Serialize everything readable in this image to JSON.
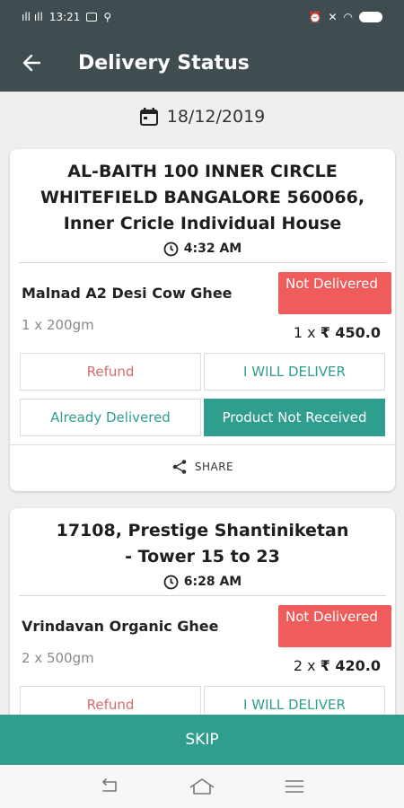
{
  "status_bar": {
    "carrier": "ıll ıll",
    "time": "13:21",
    "battery_icon": "battery-charging-icon"
  },
  "app_bar": {
    "title": "Delivery Status"
  },
  "date": "18/12/2019",
  "orders": [
    {
      "address": "AL-BAITH 100 INNER CIRCLE WHITEFIELD BANGALORE 560066, Inner Cricle Individual House",
      "time": "4:32 AM",
      "product": "Malnad A2 Desi Cow Ghee",
      "qty": "1 x 200gm",
      "status": "Not Delivered",
      "count": "1 x",
      "price": "₹ 450.0",
      "buttons": {
        "refund": "Refund",
        "deliver": "I WILL DELIVER",
        "already": "Already Delivered",
        "not_received": "Product Not Received"
      },
      "share": "SHARE"
    },
    {
      "address": "17108, Prestige Shantiniketan - Tower 15 to 23",
      "time": "6:28 AM",
      "product": "Vrindavan Organic Ghee",
      "qty": "2 x 500gm",
      "status": "Not Delivered",
      "count": "2 x",
      "price": "₹ 420.0",
      "buttons": {
        "refund": "Refund",
        "deliver": "I WILL DELIVER"
      }
    }
  ],
  "skip_label": "SKIP",
  "colors": {
    "appbar": "#3f4c50",
    "teal": "#2f9e8f",
    "not_delivered": "#f05c5c",
    "refund": "#d86b6b"
  }
}
